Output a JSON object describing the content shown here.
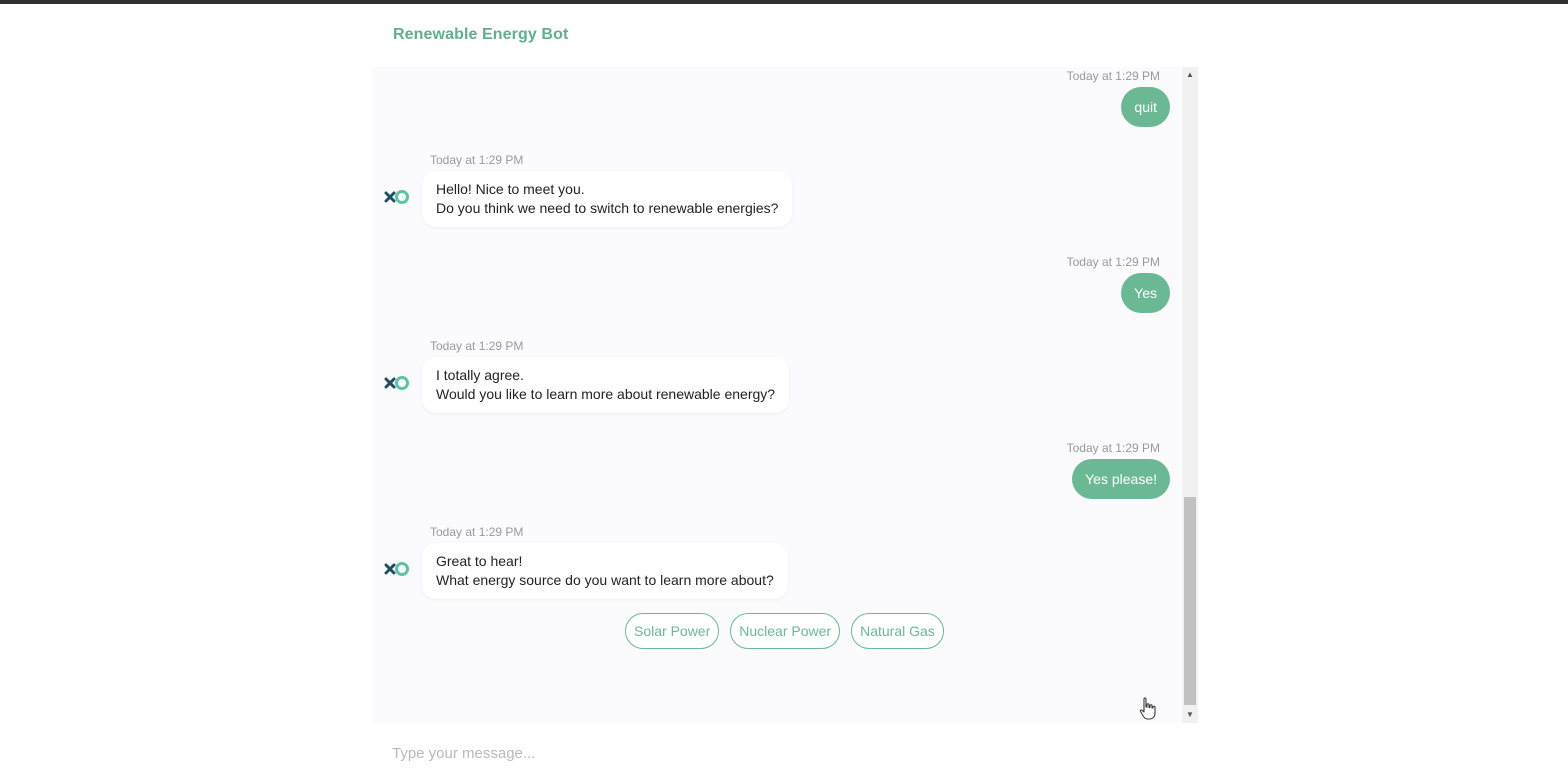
{
  "app": {
    "title": "Renewable Energy Bot",
    "accent_color": "#6bb894",
    "bot_avatar_icon": "xo-logo-icon"
  },
  "messages": [
    {
      "sender": "user",
      "time": "Today at 1:29 PM",
      "text": "quit"
    },
    {
      "sender": "bot",
      "time": "Today at 1:29 PM",
      "lines": [
        "Hello! Nice to meet you.",
        "Do you think we need to switch to renewable energies?"
      ]
    },
    {
      "sender": "user",
      "time": "Today at 1:29 PM",
      "text": "Yes"
    },
    {
      "sender": "bot",
      "time": "Today at 1:29 PM",
      "lines": [
        "I totally agree.",
        "Would you like to learn more about renewable energy?"
      ]
    },
    {
      "sender": "user",
      "time": "Today at 1:29 PM",
      "text": "Yes please!"
    },
    {
      "sender": "bot",
      "time": "Today at 1:29 PM",
      "lines": [
        "Great to hear!",
        "What energy source do you want to learn more about?"
      ]
    }
  ],
  "quick_replies": [
    "Solar Power",
    "Nuclear Power",
    "Natural Gas"
  ],
  "composer": {
    "placeholder": "Type your message..."
  }
}
